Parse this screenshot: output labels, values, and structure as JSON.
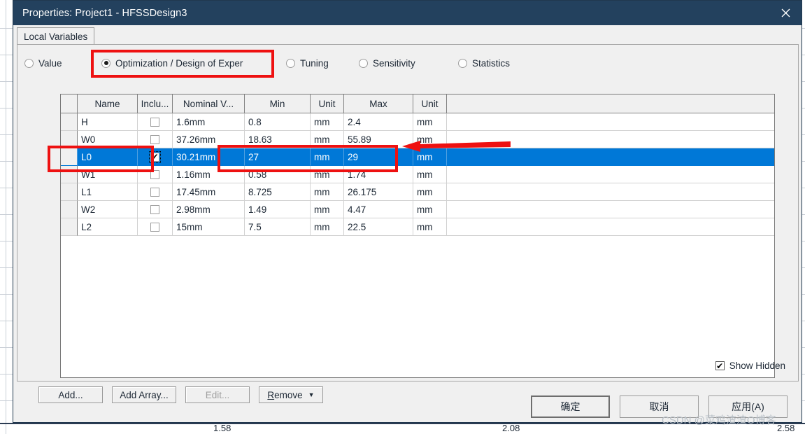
{
  "window": {
    "title": "Properties: Project1 - HFSSDesign3",
    "close_icon": "close-icon"
  },
  "tabs": [
    {
      "label": "Local Variables",
      "selected": true
    }
  ],
  "modes": [
    {
      "label": "Value",
      "selected": false
    },
    {
      "label": "Optimization / Design of Exper",
      "selected": true
    },
    {
      "label": "Tuning",
      "selected": false
    },
    {
      "label": "Sensitivity",
      "selected": false
    },
    {
      "label": "Statistics",
      "selected": false
    }
  ],
  "table": {
    "columns": [
      "Name",
      "Inclu...",
      "Nominal V...",
      "Min",
      "Unit",
      "Max",
      "Unit"
    ],
    "rows": [
      {
        "name": "H",
        "include": false,
        "nominal": "1.6mm",
        "min": "0.8",
        "min_unit": "mm",
        "max": "2.4",
        "max_unit": "mm",
        "selected": false
      },
      {
        "name": "W0",
        "include": false,
        "nominal": "37.26mm",
        "min": "18.63",
        "min_unit": "mm",
        "max": "55.89",
        "max_unit": "mm",
        "selected": false
      },
      {
        "name": "L0",
        "include": true,
        "nominal": "30.21mm",
        "min": "27",
        "min_unit": "mm",
        "max": "29",
        "max_unit": "mm",
        "selected": true
      },
      {
        "name": "W1",
        "include": false,
        "nominal": "1.16mm",
        "min": "0.58",
        "min_unit": "mm",
        "max": "1.74",
        "max_unit": "mm",
        "selected": false
      },
      {
        "name": "L1",
        "include": false,
        "nominal": "17.45mm",
        "min": "8.725",
        "min_unit": "mm",
        "max": "26.175",
        "max_unit": "mm",
        "selected": false
      },
      {
        "name": "W2",
        "include": false,
        "nominal": "2.98mm",
        "min": "1.49",
        "min_unit": "mm",
        "max": "4.47",
        "max_unit": "mm",
        "selected": false
      },
      {
        "name": "L2",
        "include": false,
        "nominal": "15mm",
        "min": "7.5",
        "min_unit": "mm",
        "max": "22.5",
        "max_unit": "mm",
        "selected": false
      }
    ]
  },
  "show_hidden": {
    "label": "Show Hidden",
    "checked": true
  },
  "buttons": {
    "add": "Add...",
    "add_array": "Add Array...",
    "edit": "Edit...",
    "remove_prefix": "R",
    "remove_rest": "emove",
    "remove_caret": "▼"
  },
  "footer": {
    "ok": "确定",
    "cancel": "取消",
    "apply": "应用(A)"
  },
  "background": {
    "tick_labels": [
      "1.58",
      "2.08",
      "2.58"
    ],
    "accent": "#0078d7",
    "annotation_color": "#ee1111"
  },
  "watermark": "CSDN @菜鸡渣渣O博客"
}
